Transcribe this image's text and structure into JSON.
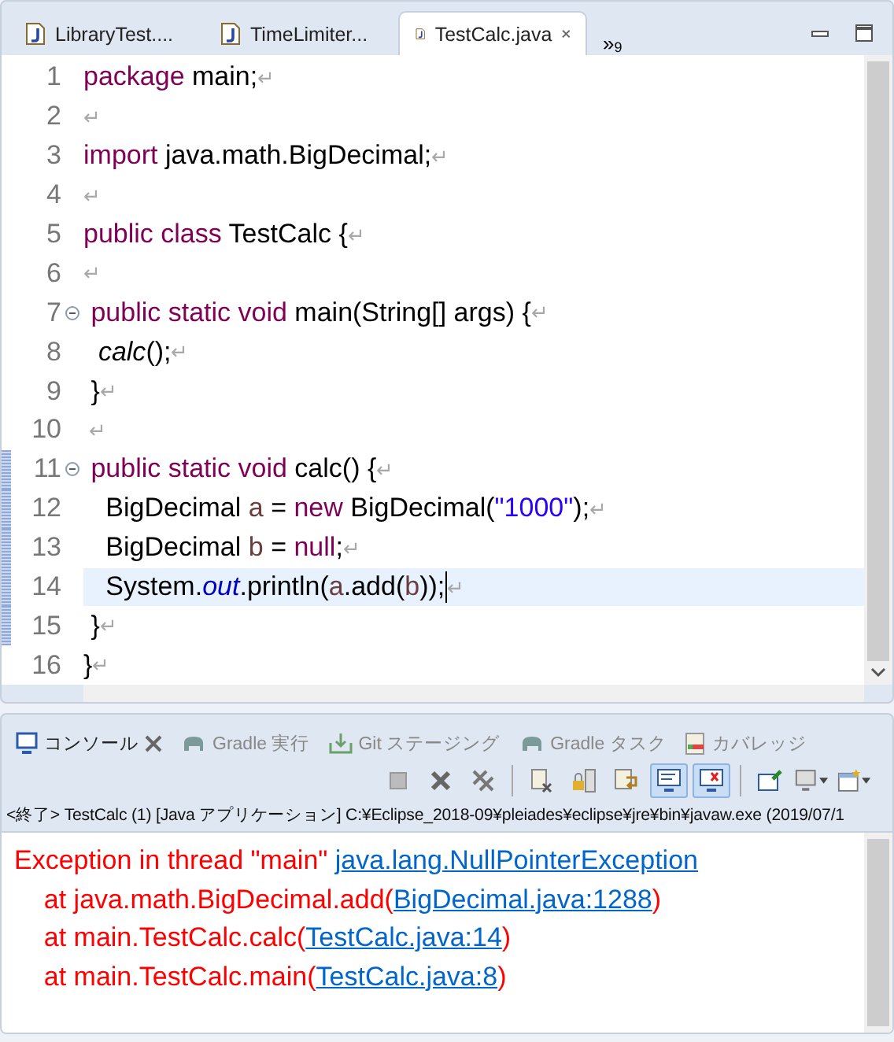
{
  "editor_tabs": [
    {
      "label": "LibraryTest....",
      "selected": false
    },
    {
      "label": "TimeLimiter...",
      "selected": false
    },
    {
      "label": "TestCalc.java",
      "selected": true
    }
  ],
  "overflow": {
    "glyph": "»",
    "count": "9"
  },
  "code": [
    {
      "number": "1",
      "fold": false,
      "changed": false,
      "current": false,
      "tokens": [
        {
          "kind": "kw",
          "text": "package"
        },
        {
          "kind": "plain",
          "text": " main;"
        },
        {
          "kind": "eol",
          "text": "↵"
        }
      ]
    },
    {
      "number": "2",
      "fold": false,
      "changed": false,
      "current": false,
      "tokens": [
        {
          "kind": "eol",
          "text": "↵"
        }
      ]
    },
    {
      "number": "3",
      "fold": false,
      "changed": false,
      "current": false,
      "tokens": [
        {
          "kind": "kw",
          "text": "import"
        },
        {
          "kind": "plain",
          "text": " java.math.BigDecimal;"
        },
        {
          "kind": "eol",
          "text": "↵"
        }
      ]
    },
    {
      "number": "4",
      "fold": false,
      "changed": false,
      "current": false,
      "tokens": [
        {
          "kind": "eol",
          "text": "↵"
        }
      ]
    },
    {
      "number": "5",
      "fold": false,
      "changed": false,
      "current": false,
      "tokens": [
        {
          "kind": "kw",
          "text": "public class"
        },
        {
          "kind": "plain",
          "text": " TestCalc {"
        },
        {
          "kind": "eol",
          "text": "↵"
        }
      ]
    },
    {
      "number": "6",
      "fold": false,
      "changed": false,
      "current": false,
      "tokens": [
        {
          "kind": "eol",
          "text": "↵"
        }
      ]
    },
    {
      "number": "7",
      "fold": true,
      "changed": false,
      "current": false,
      "tokens": [
        {
          "kind": "kw",
          "text": " public static void"
        },
        {
          "kind": "plain",
          "text": " main(String[] args) {"
        },
        {
          "kind": "eol",
          "text": "↵"
        }
      ]
    },
    {
      "number": "8",
      "fold": false,
      "changed": false,
      "current": false,
      "tokens": [
        {
          "kind": "call",
          "text": "  calc"
        },
        {
          "kind": "plain",
          "text": "();"
        },
        {
          "kind": "eol",
          "text": "↵"
        }
      ]
    },
    {
      "number": "9",
      "fold": false,
      "changed": false,
      "current": false,
      "tokens": [
        {
          "kind": "plain",
          "text": " }"
        },
        {
          "kind": "eol",
          "text": "↵"
        }
      ]
    },
    {
      "number": "10",
      "fold": false,
      "changed": false,
      "current": false,
      "tokens": [
        {
          "kind": "eol",
          "text": " ↵"
        }
      ]
    },
    {
      "number": "11",
      "fold": true,
      "changed": true,
      "current": false,
      "tokens": [
        {
          "kind": "kw",
          "text": " public static void"
        },
        {
          "kind": "plain",
          "text": " calc() {"
        },
        {
          "kind": "eol",
          "text": "↵"
        }
      ]
    },
    {
      "number": "12",
      "fold": false,
      "changed": true,
      "current": false,
      "tokens": [
        {
          "kind": "plain",
          "text": "   BigDecimal "
        },
        {
          "kind": "var",
          "text": "a"
        },
        {
          "kind": "plain",
          "text": " = "
        },
        {
          "kind": "kw",
          "text": "new"
        },
        {
          "kind": "plain",
          "text": " BigDecimal("
        },
        {
          "kind": "str",
          "text": "\"1000\""
        },
        {
          "kind": "plain",
          "text": ");"
        },
        {
          "kind": "eol",
          "text": "↵"
        }
      ]
    },
    {
      "number": "13",
      "fold": false,
      "changed": true,
      "current": false,
      "tokens": [
        {
          "kind": "plain",
          "text": "   BigDecimal "
        },
        {
          "kind": "var",
          "text": "b"
        },
        {
          "kind": "plain",
          "text": " = "
        },
        {
          "kind": "kw",
          "text": "null"
        },
        {
          "kind": "plain",
          "text": ";"
        },
        {
          "kind": "eol",
          "text": "↵"
        }
      ]
    },
    {
      "number": "14",
      "fold": false,
      "changed": true,
      "current": true,
      "tokens": [
        {
          "kind": "plain",
          "text": "   System."
        },
        {
          "kind": "field",
          "text": "out"
        },
        {
          "kind": "plain",
          "text": ".println("
        },
        {
          "kind": "var",
          "text": "a"
        },
        {
          "kind": "plain",
          "text": ".add("
        },
        {
          "kind": "var",
          "text": "b"
        },
        {
          "kind": "plain",
          "text": "));"
        },
        {
          "kind": "eol",
          "text": "↵"
        }
      ]
    },
    {
      "number": "15",
      "fold": false,
      "changed": true,
      "current": false,
      "tokens": [
        {
          "kind": "plain",
          "text": " }"
        },
        {
          "kind": "eol",
          "text": "↵"
        }
      ]
    },
    {
      "number": "16",
      "fold": false,
      "changed": false,
      "current": false,
      "tokens": [
        {
          "kind": "plain",
          "text": "}"
        },
        {
          "kind": "eol",
          "text": "↵"
        }
      ]
    }
  ],
  "views": [
    {
      "label": "コンソール",
      "kind": "console",
      "selected": true
    },
    {
      "label": "Gradle 実行",
      "kind": "gradle",
      "selected": false
    },
    {
      "label": "Git ステージング",
      "kind": "git",
      "selected": false
    },
    {
      "label": "Gradle タスク",
      "kind": "gradle",
      "selected": false
    },
    {
      "label": "カバレッジ",
      "kind": "coverage",
      "selected": false
    }
  ],
  "toolbar": [
    {
      "kind": "stop",
      "pressed": false
    },
    {
      "kind": "remove",
      "pressed": false
    },
    {
      "kind": "remove-all",
      "pressed": false
    },
    {
      "kind": "sep"
    },
    {
      "kind": "clear",
      "pressed": false
    },
    {
      "kind": "lock",
      "pressed": false
    },
    {
      "kind": "wrap",
      "pressed": false
    },
    {
      "kind": "show-out",
      "pressed": true
    },
    {
      "kind": "show-err",
      "pressed": true
    },
    {
      "kind": "sep"
    },
    {
      "kind": "pin",
      "pressed": false
    },
    {
      "kind": "display",
      "pressed": false
    },
    {
      "kind": "new",
      "pressed": false
    }
  ],
  "console_status": "<終了> TestCalc (1) [Java アプリケーション] C:¥Eclipse_2018-09¥pleiades¥eclipse¥jre¥bin¥javaw.exe (2019/07/1",
  "output": [
    {
      "parts": [
        {
          "kind": "err",
          "text": "Exception in thread \"main\" "
        },
        {
          "kind": "link",
          "text": "java.lang.NullPointerException"
        }
      ]
    },
    {
      "parts": [
        {
          "kind": "err",
          "text": "    at java.math.BigDecimal.add("
        },
        {
          "kind": "link",
          "text": "BigDecimal.java:1288"
        },
        {
          "kind": "err",
          "text": ")"
        }
      ]
    },
    {
      "parts": [
        {
          "kind": "err",
          "text": "    at main.TestCalc.calc("
        },
        {
          "kind": "link",
          "text": "TestCalc.java:14"
        },
        {
          "kind": "err",
          "text": ")"
        }
      ]
    },
    {
      "parts": [
        {
          "kind": "err",
          "text": "    at main.TestCalc.main("
        },
        {
          "kind": "link",
          "text": "TestCalc.java:8"
        },
        {
          "kind": "err",
          "text": ")"
        }
      ]
    }
  ]
}
